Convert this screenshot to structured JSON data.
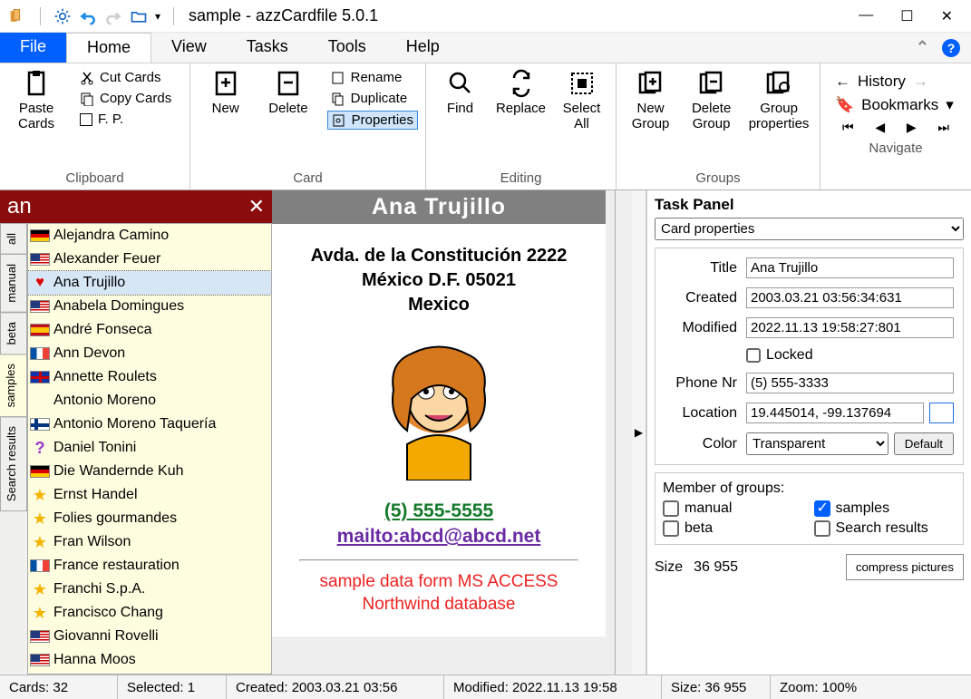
{
  "window": {
    "title": "sample - azzCardfile 5.0.1"
  },
  "menu": {
    "file": "File",
    "home": "Home",
    "view": "View",
    "tasks": "Tasks",
    "tools": "Tools",
    "help": "Help"
  },
  "ribbon": {
    "clipboard": {
      "label": "Clipboard",
      "paste": "Paste\nCards",
      "cut": "Cut Cards",
      "copy": "Copy Cards",
      "fp": "F. P."
    },
    "card": {
      "label": "Card",
      "new": "New",
      "delete": "Delete",
      "rename": "Rename",
      "duplicate": "Duplicate",
      "properties": "Properties"
    },
    "editing": {
      "label": "Editing",
      "find": "Find",
      "replace": "Replace",
      "selectall": "Select\nAll"
    },
    "groups": {
      "label": "Groups",
      "new": "New\nGroup",
      "delete": "Delete\nGroup",
      "props": "Group\nproperties"
    },
    "navigate": {
      "label": "Navigate",
      "history": "History",
      "bookmarks": "Bookmarks"
    }
  },
  "sidebar": {
    "search": "an",
    "tabs": [
      "all",
      "manual",
      "beta",
      "samples",
      "Search results"
    ],
    "items": [
      {
        "flag": "de",
        "name": "Alejandra Camino"
      },
      {
        "flag": "us",
        "name": "Alexander Feuer"
      },
      {
        "flag": "heart",
        "name": "Ana Trujillo",
        "sel": true
      },
      {
        "flag": "us",
        "name": "Anabela Domingues"
      },
      {
        "flag": "es",
        "name": "André Fonseca"
      },
      {
        "flag": "fr",
        "name": "Ann Devon"
      },
      {
        "flag": "gb",
        "name": "Annette Roulets"
      },
      {
        "flag": "none",
        "name": "Antonio Moreno"
      },
      {
        "flag": "fi",
        "name": "Antonio Moreno Taquería"
      },
      {
        "flag": "q",
        "name": "Daniel Tonini"
      },
      {
        "flag": "de",
        "name": "Die Wandernde Kuh"
      },
      {
        "flag": "star",
        "name": "Ernst Handel"
      },
      {
        "flag": "star",
        "name": "Folies gourmandes"
      },
      {
        "flag": "star",
        "name": "Fran Wilson"
      },
      {
        "flag": "fr",
        "name": "France restauration"
      },
      {
        "flag": "star",
        "name": "Franchi S.p.A."
      },
      {
        "flag": "star",
        "name": "Francisco Chang"
      },
      {
        "flag": "us",
        "name": "Giovanni Rovelli"
      },
      {
        "flag": "us",
        "name": "Hanna Moos"
      }
    ]
  },
  "card": {
    "title": "Ana Trujillo",
    "addr1": "Avda. de la Constitución 2222",
    "addr2": "México D.F.  05021",
    "addr3": "Mexico",
    "phone": "(5) 555-5555",
    "mail": "mailto:abcd@abcd.net",
    "note1": "sample data form MS ACCESS",
    "note2": "Northwind database"
  },
  "taskpanel": {
    "title": "Task Panel",
    "selector": "Card properties",
    "props": {
      "title_l": "Title",
      "title_v": "Ana Trujillo",
      "created_l": "Created",
      "created_v": "2003.03.21 03:56:34:631",
      "modified_l": "Modified",
      "modified_v": "2022.11.13 19:58:27:801",
      "locked_l": "Locked",
      "phone_l": "Phone Nr",
      "phone_v": "(5) 555-3333",
      "location_l": "Location",
      "location_v": "19.445014, -99.137694",
      "color_l": "Color",
      "color_v": "Transparent",
      "default": "Default"
    },
    "groups": {
      "label": "Member of groups:",
      "manual": "manual",
      "beta": "beta",
      "samples": "samples",
      "search": "Search results"
    },
    "size": {
      "label": "Size",
      "value": "36 955",
      "btn": "compress pictures"
    }
  },
  "status": {
    "cards": "Cards: 32",
    "selected": "Selected: 1",
    "created": "Created: 2003.03.21 03:56",
    "modified": "Modified: 2022.11.13 19:58",
    "size": "Size: 36 955",
    "zoom": "Zoom: 100%"
  }
}
